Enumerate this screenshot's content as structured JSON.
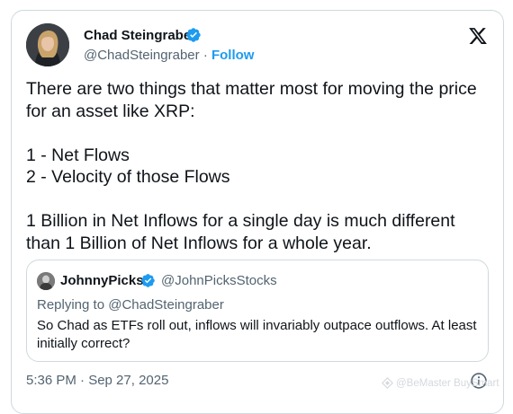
{
  "author": {
    "name": "Chad Steingraber",
    "handle": "@ChadSteingraber",
    "separator": "·",
    "follow_label": "Follow"
  },
  "tweet": {
    "text": "There are two things that matter most for moving the price for an asset like XRP:\n\n1 - Net Flows\n2 - Velocity of those Flows\n\n1 Billion in Net Inflows for a single day is much different than 1 Billion of Net Inflows for a whole year.",
    "timestamp": "5:36 PM · Sep 27, 2025"
  },
  "quoted_tweet": {
    "name": "JohnnyPicks",
    "handle": "@JohnPicksStocks",
    "replying_to": "Replying to @ChadSteingraber",
    "text": "So Chad as ETFs roll out, inflows will invariably outpace outflows. At least initially correct?"
  },
  "watermark": {
    "text": "@BeMaster BuySmart"
  },
  "icons": {
    "platform_logo": "x-logo-icon",
    "verified": "verified-badge-icon",
    "info": "info-icon"
  },
  "colors": {
    "accent": "#1d9bf0",
    "text_primary": "#0f1419",
    "text_secondary": "#536471",
    "border": "#cfd9de"
  }
}
